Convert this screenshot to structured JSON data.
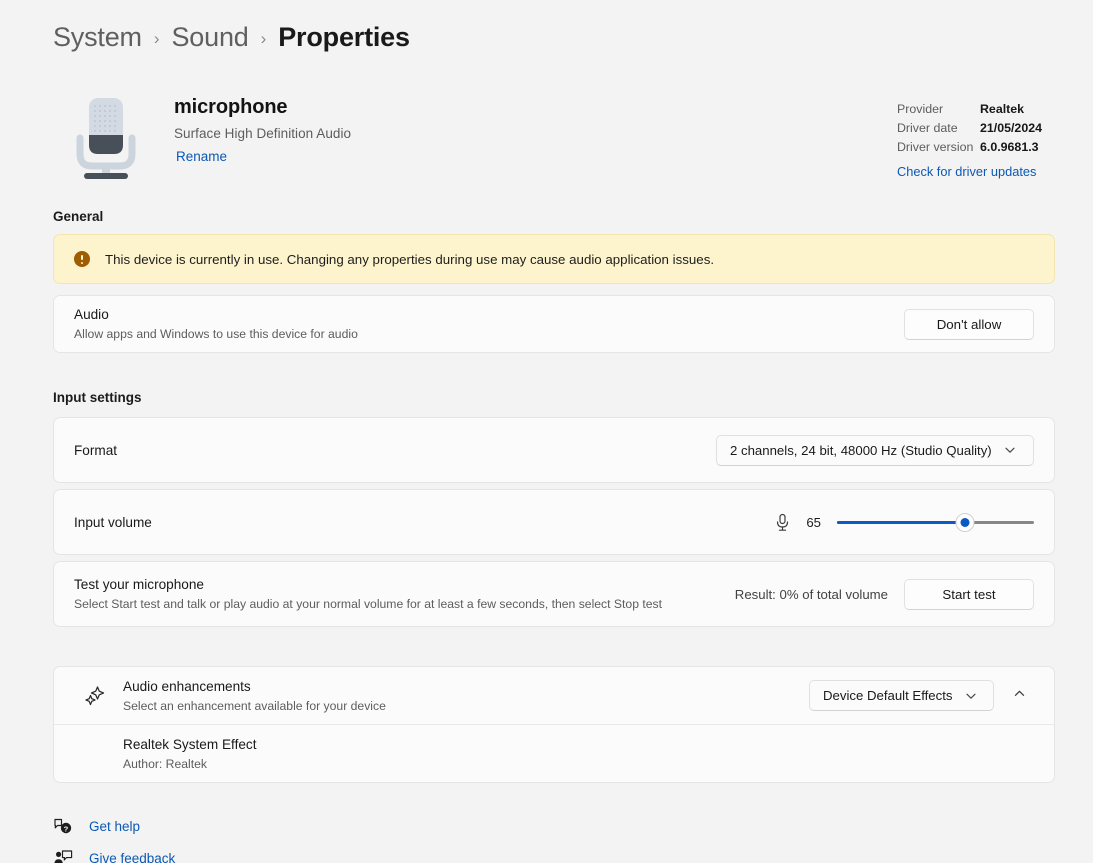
{
  "breadcrumb": {
    "items": [
      {
        "label": "System",
        "current": false
      },
      {
        "label": "Sound",
        "current": false
      },
      {
        "label": "Properties",
        "current": true
      }
    ],
    "separator": "›"
  },
  "device": {
    "icon": "microphone-icon",
    "name": "microphone",
    "subtitle": "Surface High Definition Audio",
    "rename_label": "Rename",
    "driver": {
      "provider_key": "Provider",
      "provider_value": "Realtek",
      "date_key": "Driver date",
      "date_value": "21/05/2024",
      "version_key": "Driver version",
      "version_value": "6.0.9681.3",
      "update_link": "Check for driver updates"
    }
  },
  "general": {
    "title": "General",
    "warning": {
      "icon": "warning-icon",
      "text": "This device is currently in use. Changing any properties during use may cause audio application issues.",
      "bg_color": "#fdf4ce",
      "icon_color": "#9d5d00"
    },
    "audio": {
      "title": "Audio",
      "subtitle": "Allow apps and Windows to use this device for audio",
      "button_label": "Don't allow"
    }
  },
  "input_settings": {
    "title": "Input settings",
    "format": {
      "label": "Format",
      "value": "2 channels, 24 bit, 48000 Hz (Studio Quality)",
      "chevron": "chevron-down-icon"
    },
    "input_volume": {
      "label": "Input volume",
      "icon": "microphone-icon",
      "value": "65",
      "percent": 65,
      "fill_color": "#0b5bc4",
      "track_color": "#868686"
    },
    "test": {
      "title": "Test your microphone",
      "subtitle": "Select Start test and talk or play audio at your normal volume for at least a few seconds, then select Stop test",
      "result": "Result: 0% of total volume",
      "button_label": "Start test"
    }
  },
  "enhancements": {
    "icon": "sparkle-effects-icon",
    "title": "Audio enhancements",
    "subtitle": "Select an enhancement available for your device",
    "dropdown_value": "Device Default Effects",
    "dropdown_chevron": "chevron-down-icon",
    "expander_icon": "chevron-up-icon",
    "effect": {
      "name": "Realtek System Effect",
      "author": "Author: Realtek"
    }
  },
  "footer": {
    "links": [
      {
        "label": "Get help",
        "icon": "help-icon"
      },
      {
        "label": "Give feedback",
        "icon": "feedback-icon"
      }
    ]
  },
  "theme": {
    "accent": "#0b5bc4",
    "link": "#0b58b5",
    "page_bg": "#f3f3f3",
    "card_bg": "#fbfbfb"
  }
}
